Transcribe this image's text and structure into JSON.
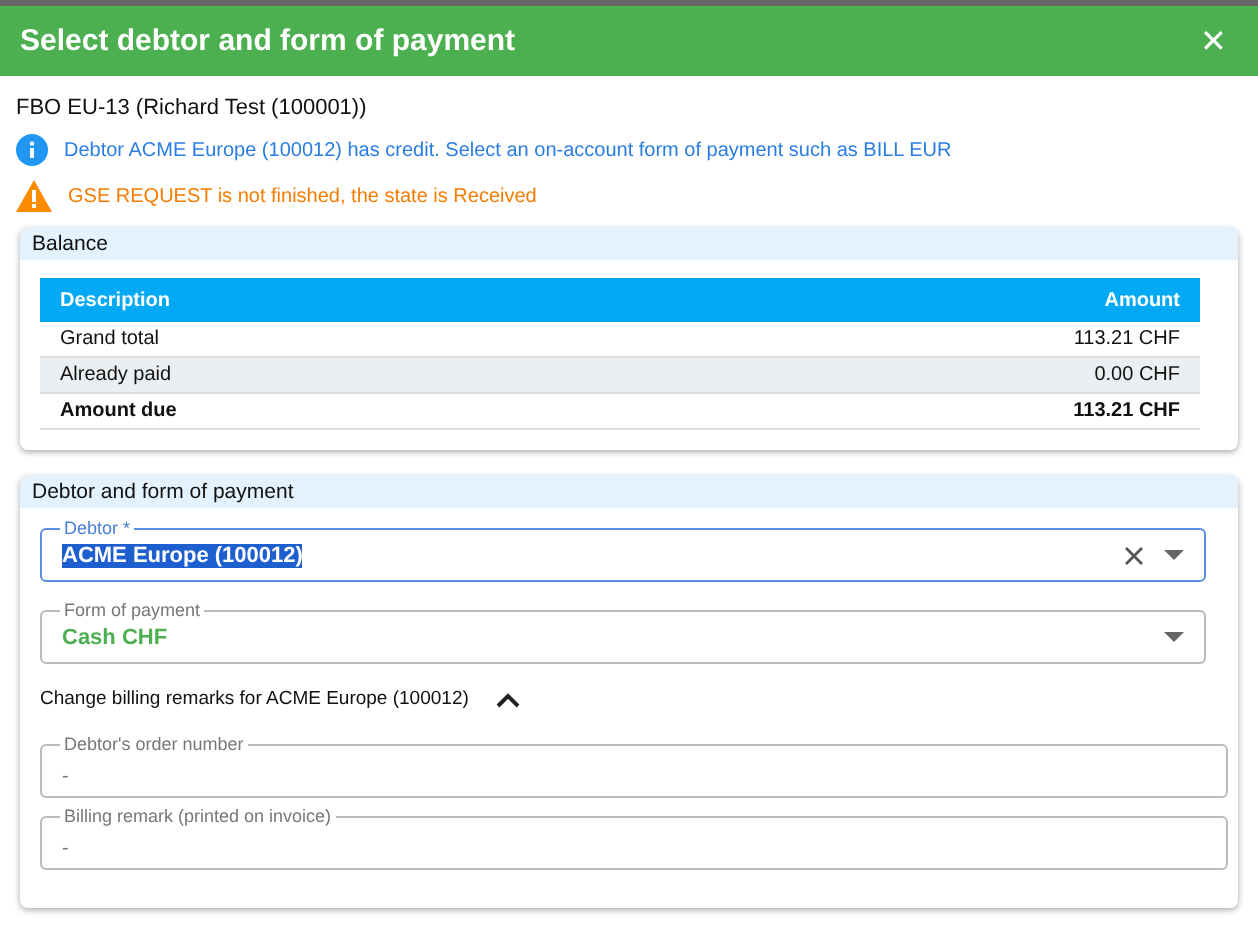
{
  "dialog": {
    "title": "Select debtor and form of payment",
    "close": "✕"
  },
  "subtitle": "FBO EU-13 (Richard Test (100001))",
  "messages": [
    {
      "kind": "info",
      "text": "Debtor ACME Europe (100012) has credit. Select an on-account form of payment such as BILL EUR"
    },
    {
      "kind": "warning",
      "text": "GSE REQUEST is not finished, the state is Received"
    }
  ],
  "balance": {
    "title": "Balance",
    "table": {
      "columns": [
        "Description",
        "Amount"
      ],
      "rows": [
        {
          "cells": [
            "Grand total",
            "113.21 CHF"
          ],
          "bold": false
        },
        {
          "cells": [
            "Already paid",
            "0.00 CHF"
          ],
          "bold": false
        },
        {
          "cells": [
            "Amount due",
            "113.21 CHF"
          ],
          "bold": true
        }
      ]
    }
  },
  "payment": {
    "title": "Debtor and form of payment",
    "fields": [
      {
        "kind": "select",
        "label": "Debtor *",
        "value": "ACME Europe (100012)",
        "focused": true,
        "clearable": true
      },
      {
        "kind": "select",
        "label": "Form of payment",
        "value": "Cash CHF",
        "focused": false,
        "clearable": false
      }
    ],
    "billing": {
      "label": "Change billing remarks for ACME Europe (100012)",
      "expanded": true,
      "fields": [
        {
          "label": "Debtor's order number",
          "value": "-"
        },
        {
          "label": "Billing remark (printed on invoice)",
          "value": "-"
        }
      ]
    }
  }
}
